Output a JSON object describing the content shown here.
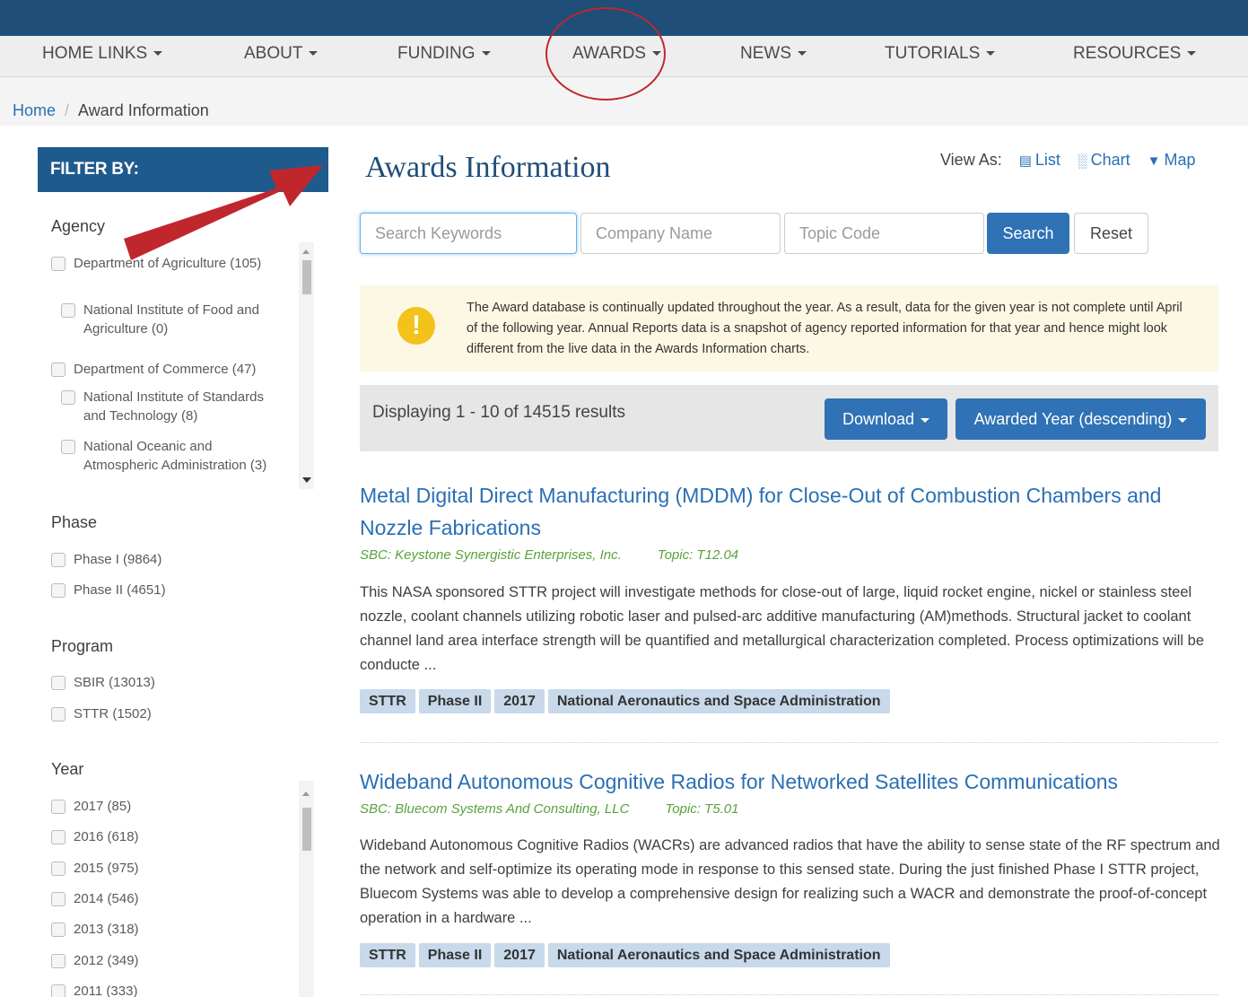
{
  "nav": {
    "items": [
      {
        "label": "HOME LINKS"
      },
      {
        "label": "ABOUT"
      },
      {
        "label": "FUNDING"
      },
      {
        "label": "AWARDS"
      },
      {
        "label": "NEWS"
      },
      {
        "label": "TUTORIALS"
      },
      {
        "label": "RESOURCES"
      }
    ]
  },
  "breadcrumb": {
    "home": "Home",
    "current": "Award Information"
  },
  "sidebar": {
    "filter_header": "FILTER BY:",
    "agency": {
      "title": "Agency",
      "items": [
        {
          "label": "Department of Agriculture (105)"
        },
        {
          "label": "National Institute of Food and Agriculture (0)"
        },
        {
          "label": "Department of Commerce (47)"
        },
        {
          "label": "National Institute of Standards and Technology (8)"
        },
        {
          "label": "National Oceanic and Atmospheric Administration (3)"
        }
      ]
    },
    "phase": {
      "title": "Phase",
      "items": [
        {
          "label": "Phase I (9864)"
        },
        {
          "label": "Phase II (4651)"
        }
      ]
    },
    "program": {
      "title": "Program",
      "items": [
        {
          "label": "SBIR (13013)"
        },
        {
          "label": "STTR (1502)"
        }
      ]
    },
    "year": {
      "title": "Year",
      "items": [
        {
          "label": "2017 (85)"
        },
        {
          "label": "2016 (618)"
        },
        {
          "label": "2015 (975)"
        },
        {
          "label": "2014 (546)"
        },
        {
          "label": "2013 (318)"
        },
        {
          "label": "2012 (349)"
        },
        {
          "label": "2011 (333)"
        }
      ]
    }
  },
  "main": {
    "title": "Awards Information",
    "view_as": {
      "label": "View As:",
      "list": "List",
      "chart": "Chart",
      "map": "Map"
    },
    "search": {
      "keywords_placeholder": "Search Keywords",
      "company_placeholder": "Company Name",
      "topic_placeholder": "Topic Code",
      "search_label": "Search",
      "reset_label": "Reset"
    },
    "alert": {
      "text": "The Award database is continually updated throughout the year. As a result, data for the given year is not complete until April of the following year. Annual Reports data is a snapshot of agency reported information for that year and hence might look different from the live data in the Awards Information charts.",
      "icon_char": "!"
    },
    "results": {
      "text": "Displaying 1 - 10 of 14515 results",
      "download_label": "Download",
      "sort_label": "Awarded Year (descending)"
    },
    "awards": [
      {
        "title": "Metal Digital Direct Manufacturing (MDDM) for Close-Out of Combustion Chambers and Nozzle Fabrications",
        "sbc": "SBC: Keystone Synergistic Enterprises, Inc.",
        "topic": "Topic: T12.04",
        "description": "This NASA sponsored STTR project will investigate methods for close-out of large, liquid rocket engine, nickel or stainless steel nozzle, coolant channels utilizing robotic laser and pulsed-arc additive manufacturing (AM)methods. Structural jacket to coolant channel land area interface strength will be quantified and metallurgical characterization completed. Process optimizations will be conducte ...",
        "tags": [
          "STTR",
          "Phase II",
          "2017",
          "National Aeronautics and Space Administration"
        ]
      },
      {
        "title": "Wideband Autonomous Cognitive Radios for Networked Satellites Communications",
        "sbc": "SBC: Bluecom Systems And Consulting, LLC",
        "topic": "Topic: T5.01",
        "description": "Wideband Autonomous Cognitive Radios (WACRs) are advanced radios that have the ability to sense state of the RF spectrum and the network and self-optimize its operating mode in response to this sensed state. During the just finished Phase I STTR project, Bluecom Systems was able to develop a comprehensive design for realizing such a WACR and demonstrate the proof-of-concept operation in a hardware ...",
        "tags": [
          "STTR",
          "Phase II",
          "2017",
          "National Aeronautics and Space Administration"
        ]
      }
    ]
  },
  "colors": {
    "frame": "#1f4e79",
    "filter_header": "#1f5a8d",
    "link": "#2a6fb4",
    "primary_button": "#2f72b5",
    "meta_green": "#5aa23c",
    "tag_bg": "#c7d9ea",
    "alert_bg": "#fcf8e3",
    "annotation_red": "#c0272d"
  },
  "annotations": {
    "circle": "around AWARDS menu item",
    "arrow": "pointing at Awards Information title"
  }
}
